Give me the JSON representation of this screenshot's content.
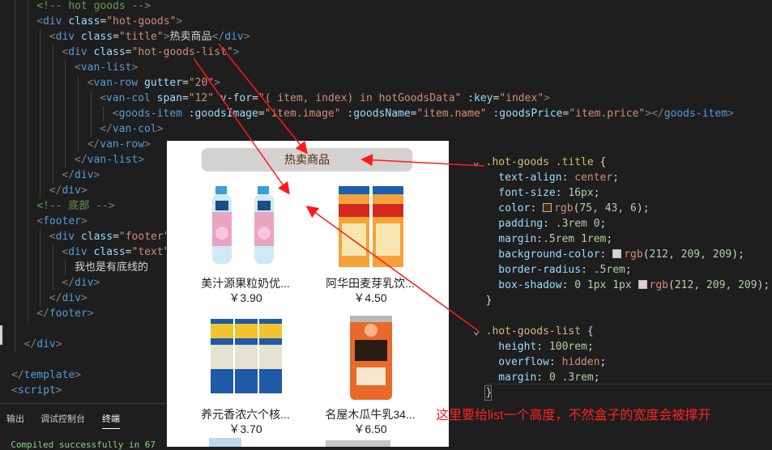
{
  "code_left": [
    {
      "i": 2,
      "parts": [
        [
          "cm",
          "<!-- hot goods -->"
        ]
      ]
    },
    {
      "i": 2,
      "parts": [
        [
          "t",
          "<"
        ],
        [
          "tag",
          "div"
        ],
        [
          "attr",
          " class"
        ],
        [
          "pun",
          "="
        ],
        [
          "str",
          "\"hot-goods\""
        ],
        [
          "t",
          ">"
        ]
      ]
    },
    {
      "i": 3,
      "parts": [
        [
          "t",
          "<"
        ],
        [
          "tag",
          "div"
        ],
        [
          "attr",
          " class"
        ],
        [
          "pun",
          "="
        ],
        [
          "str",
          "\"title\""
        ],
        [
          "t",
          ">"
        ],
        [
          "txt",
          "热卖商品"
        ],
        [
          "t",
          "</"
        ],
        [
          "tag",
          "div"
        ],
        [
          "t",
          ">"
        ]
      ]
    },
    {
      "i": 4,
      "parts": [
        [
          "t",
          "<"
        ],
        [
          "tag",
          "div"
        ],
        [
          "attr",
          " class"
        ],
        [
          "pun",
          "="
        ],
        [
          "str",
          "\"hot-goods-list\""
        ],
        [
          "t",
          ">"
        ]
      ]
    },
    {
      "i": 5,
      "parts": [
        [
          "t",
          "<"
        ],
        [
          "tag",
          "van-list"
        ],
        [
          "t",
          ">"
        ]
      ]
    },
    {
      "i": 6,
      "parts": [
        [
          "t",
          "<"
        ],
        [
          "tag",
          "van-row"
        ],
        [
          "attr",
          " gutter"
        ],
        [
          "pun",
          "="
        ],
        [
          "str",
          "\"20\""
        ],
        [
          "t",
          ">"
        ]
      ]
    },
    {
      "i": 7,
      "parts": [
        [
          "t",
          "<"
        ],
        [
          "tag",
          "van-col"
        ],
        [
          "attr",
          " span"
        ],
        [
          "pun",
          "="
        ],
        [
          "str",
          "\"12\""
        ],
        [
          "attr",
          " v-for"
        ],
        [
          "pun",
          "="
        ],
        [
          "str",
          "\"( item, index) in hotGoodsData\""
        ],
        [
          "attr",
          " :key"
        ],
        [
          "pun",
          "="
        ],
        [
          "str",
          "\"index\""
        ],
        [
          "t",
          ">"
        ]
      ]
    },
    {
      "i": 8,
      "parts": [
        [
          "t",
          "<"
        ],
        [
          "tag",
          "goods-item"
        ],
        [
          "attr",
          " :goodsImage"
        ],
        [
          "pun",
          "="
        ],
        [
          "str",
          "\"item.image\""
        ],
        [
          "attr",
          " :goodsName"
        ],
        [
          "pun",
          "="
        ],
        [
          "str",
          "\"item.name\""
        ],
        [
          "attr",
          " :goodsPrice"
        ],
        [
          "pun",
          "="
        ],
        [
          "str",
          "\"item.price\""
        ],
        [
          "t",
          "></"
        ],
        [
          "tag",
          "goods-item"
        ],
        [
          "t",
          ">"
        ]
      ]
    },
    {
      "i": 7,
      "parts": [
        [
          "t",
          "</"
        ],
        [
          "tag",
          "van-col"
        ],
        [
          "t",
          ">"
        ]
      ]
    },
    {
      "i": 6,
      "parts": [
        [
          "t",
          "</"
        ],
        [
          "tag",
          "van-row"
        ],
        [
          "t",
          ">"
        ]
      ]
    },
    {
      "i": 5,
      "parts": [
        [
          "t",
          "</"
        ],
        [
          "tag",
          "van-list"
        ],
        [
          "t",
          ">"
        ]
      ]
    },
    {
      "i": 4,
      "parts": [
        [
          "t",
          "</"
        ],
        [
          "tag",
          "div"
        ],
        [
          "t",
          ">"
        ]
      ]
    },
    {
      "i": 3,
      "parts": [
        [
          "t",
          "</"
        ],
        [
          "tag",
          "div"
        ],
        [
          "t",
          ">"
        ]
      ]
    },
    {
      "i": 2,
      "parts": [
        [
          "cm",
          "<!-- 底部 -->"
        ]
      ]
    },
    {
      "i": 2,
      "parts": [
        [
          "t",
          "<"
        ],
        [
          "tag",
          "footer"
        ],
        [
          "t",
          ">"
        ]
      ]
    },
    {
      "i": 3,
      "parts": [
        [
          "t",
          "<"
        ],
        [
          "tag",
          "div"
        ],
        [
          "attr",
          " class"
        ],
        [
          "pun",
          "="
        ],
        [
          "str",
          "\"footer\""
        ],
        [
          "t",
          ">"
        ]
      ]
    },
    {
      "i": 4,
      "parts": [
        [
          "t",
          "<"
        ],
        [
          "tag",
          "div"
        ],
        [
          "attr",
          " class"
        ],
        [
          "pun",
          "="
        ],
        [
          "str",
          "\"text\""
        ]
      ]
    },
    {
      "i": 5,
      "parts": [
        [
          "txt",
          "我也是有底线的"
        ]
      ]
    },
    {
      "i": 4,
      "parts": [
        [
          "t",
          "</"
        ],
        [
          "tag",
          "div"
        ],
        [
          "t",
          ">"
        ]
      ]
    },
    {
      "i": 3,
      "parts": [
        [
          "t",
          "</"
        ],
        [
          "tag",
          "div"
        ],
        [
          "t",
          ">"
        ]
      ]
    },
    {
      "i": 2,
      "parts": [
        [
          "t",
          "</"
        ],
        [
          "tag",
          "footer"
        ],
        [
          "t",
          ">"
        ]
      ]
    },
    {
      "i": 1,
      "parts": [
        [
          "txt",
          ""
        ]
      ]
    },
    {
      "i": 1,
      "parts": [
        [
          "t",
          "</"
        ],
        [
          "tag",
          "div"
        ],
        [
          "t",
          ">"
        ]
      ]
    },
    {
      "i": 0,
      "parts": [
        [
          "txt",
          ""
        ]
      ]
    },
    {
      "i": 0,
      "parts": [
        [
          "t",
          "</"
        ],
        [
          "tag",
          "template"
        ],
        [
          "t",
          ">"
        ]
      ]
    },
    {
      "i": 0,
      "parts": [
        [
          "t",
          "<"
        ],
        [
          "tag",
          "script"
        ],
        [
          "t",
          ">"
        ]
      ]
    }
  ],
  "panel": {
    "tabs": [
      "输出",
      "调试控制台",
      "终端"
    ],
    "terminal_line": "  Compiled successfully in 67"
  },
  "preview": {
    "title": "热卖商品",
    "goods": [
      {
        "name": "美汁源果粒奶优...",
        "price": "￥3.90",
        "image": "bottled-drink-image"
      },
      {
        "name": "阿华田麦芽乳饮...",
        "price": "￥4.50",
        "image": "ovaltine-box-image"
      },
      {
        "name": "养元香浓六个核...",
        "price": "￥3.70",
        "image": "walnut-milk-cans-image"
      },
      {
        "name": "名屋木瓜牛乳34...",
        "price": "￥6.50",
        "image": "papaya-milk-can-image"
      }
    ]
  },
  "code_right": [
    [
      [
        "pun",
        "⌄ "
      ],
      [
        "sel",
        ".hot-goods .title"
      ],
      [
        "pun",
        " {"
      ]
    ],
    [
      [
        "prop",
        "    text-align"
      ],
      [
        "pun",
        ": "
      ],
      [
        "val",
        "center"
      ],
      [
        "pun",
        ";"
      ]
    ],
    [
      [
        "prop",
        "    font-size"
      ],
      [
        "pun",
        ": "
      ],
      [
        "num",
        "16px"
      ],
      [
        "pun",
        ";"
      ]
    ],
    [
      [
        "prop",
        "    color"
      ],
      [
        "pun",
        ": "
      ],
      [
        "sw",
        "#4b2b06"
      ],
      [
        "val",
        "rgb"
      ],
      [
        "pun",
        "("
      ],
      [
        "num",
        "75, 43, 6"
      ],
      [
        "pun",
        ");"
      ]
    ],
    [
      [
        "prop",
        "    padding"
      ],
      [
        "pun",
        ": "
      ],
      [
        "num",
        ".3rem 0"
      ],
      [
        "pun",
        ";"
      ]
    ],
    [
      [
        "prop",
        "    margin"
      ],
      [
        "pun",
        ":"
      ],
      [
        "num",
        ".5rem 1rem"
      ],
      [
        "pun",
        ";"
      ]
    ],
    [
      [
        "prop",
        "    background-color"
      ],
      [
        "pun",
        ": "
      ],
      [
        "sw",
        "#d4d1d1"
      ],
      [
        "val",
        "rgb"
      ],
      [
        "pun",
        "("
      ],
      [
        "num",
        "212, 209, 209"
      ],
      [
        "pun",
        ");"
      ]
    ],
    [
      [
        "prop",
        "    border-radius"
      ],
      [
        "pun",
        ": "
      ],
      [
        "num",
        ".5rem"
      ],
      [
        "pun",
        ";"
      ]
    ],
    [
      [
        "prop",
        "    box-shadow"
      ],
      [
        "pun",
        ": "
      ],
      [
        "num",
        "0 1px 1px "
      ],
      [
        "sw",
        "#d4d1d1"
      ],
      [
        "val",
        "rgb"
      ],
      [
        "pun",
        "("
      ],
      [
        "num",
        "212, 209, 209"
      ],
      [
        "pun",
        ");"
      ]
    ],
    [
      [
        "pun",
        "  }"
      ]
    ],
    [
      [
        "pun",
        ""
      ]
    ],
    [
      [
        "pun",
        "⌄ "
      ],
      [
        "sel",
        ".hot-goods-list"
      ],
      [
        "pun",
        " {"
      ]
    ],
    [
      [
        "prop",
        "    height"
      ],
      [
        "pun",
        ": "
      ],
      [
        "num",
        "100rem"
      ],
      [
        "pun",
        ";"
      ]
    ],
    [
      [
        "prop",
        "    overflow"
      ],
      [
        "pun",
        ": "
      ],
      [
        "val",
        "hidden"
      ],
      [
        "pun",
        ";"
      ]
    ],
    [
      [
        "prop",
        "    margin"
      ],
      [
        "pun",
        ": "
      ],
      [
        "num",
        "0 .3rem"
      ],
      [
        "pun",
        ";"
      ]
    ],
    [
      [
        "pun",
        "  }"
      ]
    ]
  ],
  "note": "这里要给list一个高度，不然盒子的宽度会被撑开",
  "colors": {
    "arrow": "#ff1a1a",
    "title_bg": "#d4d1d1",
    "title_text": "#4b2b06"
  }
}
